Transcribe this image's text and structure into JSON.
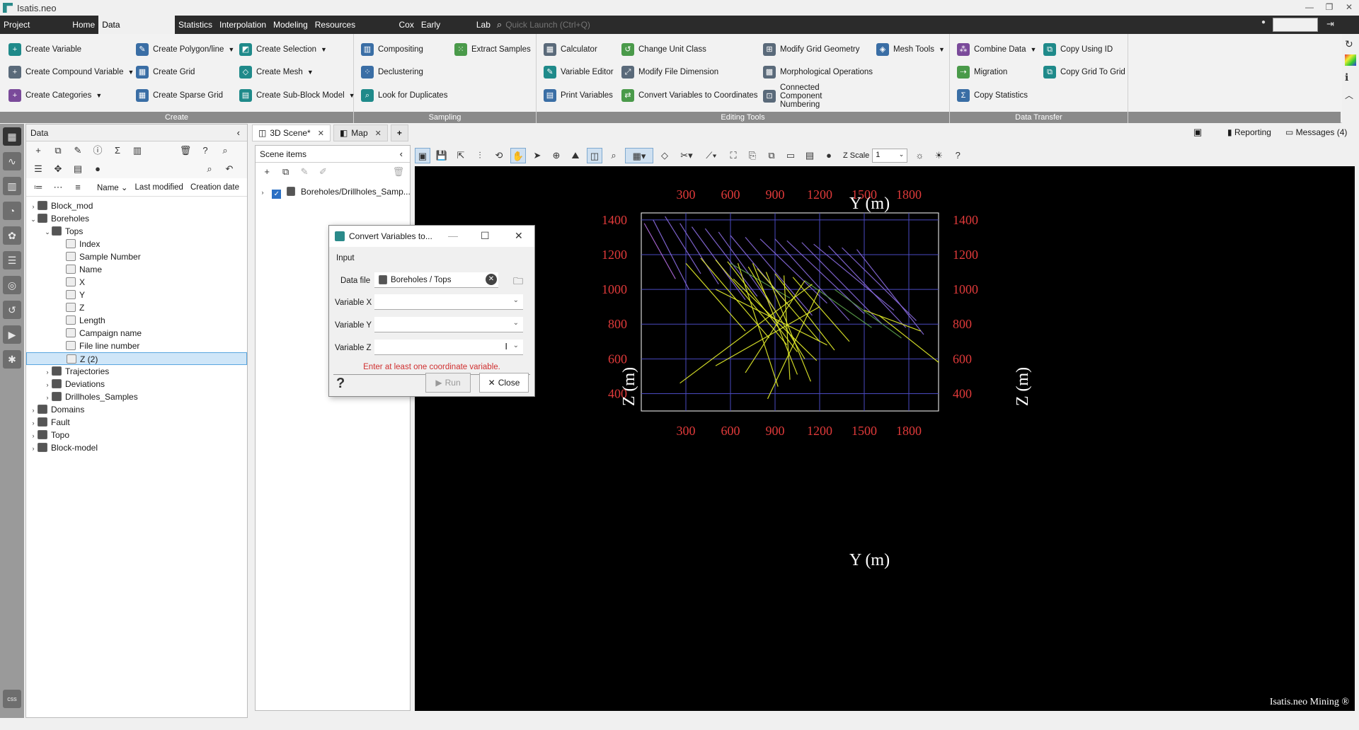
{
  "app": {
    "title": "Isatis.neo"
  },
  "menu": {
    "items": [
      "Project Manager",
      "Home",
      "Data Management",
      "Statistics",
      "Interpolation",
      "Modeling",
      "Resources Workflow",
      "Cox",
      "Early Access",
      "Lab"
    ],
    "active": "Data Management",
    "quick_launch_placeholder": "Quick Launch (Ctrl+Q)"
  },
  "ribbon": {
    "create": {
      "label": "Create",
      "buttons": [
        "Create Variable",
        "Create Compound Variable",
        "Create Categories",
        "Create Polygon/line",
        "Create Grid",
        "Create Sparse Grid",
        "Create Selection",
        "Create Mesh",
        "Create Sub-Block Model"
      ]
    },
    "sampling": {
      "label": "Sampling",
      "buttons": [
        "Compositing",
        "Declustering",
        "Look for Duplicates",
        "Extract Samples"
      ]
    },
    "editing": {
      "label": "Editing Tools",
      "buttons": [
        "Calculator",
        "Variable Editor",
        "Print Variables",
        "Change Unit Class",
        "Modify File Dimension",
        "Convert Variables to Coordinates",
        "Modify Grid Geometry",
        "Morphological Operations",
        "Connected Component Numbering",
        "Mesh Tools"
      ]
    },
    "transfer": {
      "label": "Data Transfer",
      "buttons": [
        "Combine Data",
        "Migration",
        "Copy Statistics",
        "Copy Using ID",
        "Copy Grid To Grid"
      ]
    }
  },
  "tabs": [
    {
      "label": "3D Scene*"
    },
    {
      "label": "Map"
    }
  ],
  "right_toolbar": {
    "reporting": "Reporting",
    "messages": "Messages (4)"
  },
  "data_panel": {
    "title": "Data",
    "columns": [
      "Name",
      "Last modified",
      "Creation date"
    ],
    "tree": [
      {
        "label": "Block_mod",
        "level": 0,
        "expand": "›"
      },
      {
        "label": "Boreholes",
        "level": 0,
        "expand": "⌄"
      },
      {
        "label": "Tops",
        "level": 1,
        "expand": "⌄"
      },
      {
        "label": "Index",
        "level": 2,
        "expand": ""
      },
      {
        "label": "Sample Number",
        "level": 2,
        "expand": ""
      },
      {
        "label": "Name",
        "level": 2,
        "expand": ""
      },
      {
        "label": "X",
        "level": 2,
        "expand": ""
      },
      {
        "label": "Y",
        "level": 2,
        "expand": ""
      },
      {
        "label": "Z",
        "level": 2,
        "expand": ""
      },
      {
        "label": "Length",
        "level": 2,
        "expand": ""
      },
      {
        "label": "Campaign name",
        "level": 2,
        "expand": ""
      },
      {
        "label": "File line number",
        "level": 2,
        "expand": ""
      },
      {
        "label": "Z (2)",
        "level": 2,
        "expand": ""
      },
      {
        "label": "Trajectories",
        "level": 1,
        "expand": "›"
      },
      {
        "label": "Deviations",
        "level": 1,
        "expand": "›"
      },
      {
        "label": "Drillholes_Samples",
        "level": 1,
        "expand": "›"
      },
      {
        "label": "Domains",
        "level": 0,
        "expand": "›"
      },
      {
        "label": "Fault",
        "level": 0,
        "expand": "›"
      },
      {
        "label": "Topo",
        "level": 0,
        "expand": "›"
      },
      {
        "label": "Block-model",
        "level": 0,
        "expand": "›"
      }
    ],
    "selected": "Z (2)"
  },
  "scene_panel": {
    "title": "Scene items",
    "items": [
      "Boreholes/Drillholes_Samp..."
    ]
  },
  "view_toolbar": {
    "zscale_label": "Z Scale",
    "zscale_value": "1"
  },
  "dialog": {
    "title": "Convert Variables to...",
    "section": "Input",
    "data_file_label": "Data file",
    "data_file_value": "Boreholes / Tops",
    "var_x_label": "Variable X",
    "var_y_label": "Variable Y",
    "var_z_label": "Variable Z",
    "error": "Enter at least one coordinate variable.",
    "run": "Run",
    "close": "Close",
    "help": "?"
  },
  "chart_data": {
    "type": "line",
    "xlabel": "Y (m)",
    "ylabel": "Z (m)",
    "xlim": [
      0,
      2000
    ],
    "ylim": [
      300,
      1440
    ],
    "x_ticks": [
      300,
      600,
      900,
      1200,
      1500,
      1800
    ],
    "y_ticks": [
      400,
      600,
      800,
      1000,
      1200,
      1400
    ],
    "grid": true,
    "colors": {
      "upper": "#8a6adf",
      "lower": "#e6f02a",
      "mid": "#5aa04a",
      "ticks": "#e03a3a"
    },
    "series": [
      {
        "color": "#b26adf",
        "x": [
          20,
          230
        ],
        "y": [
          1380,
          1060
        ]
      },
      {
        "color": "#8a6adf",
        "x": [
          80,
          320
        ],
        "y": [
          1400,
          1000
        ]
      },
      {
        "color": "#8a6adf",
        "x": [
          160,
          400
        ],
        "y": [
          1420,
          1090
        ]
      },
      {
        "color": "#8a6adf",
        "x": [
          260,
          520
        ],
        "y": [
          1380,
          1030
        ]
      },
      {
        "color": "#8a6adf",
        "x": [
          340,
          700
        ],
        "y": [
          1360,
          940
        ]
      },
      {
        "color": "#8a6adf",
        "x": [
          430,
          780
        ],
        "y": [
          1350,
          960
        ]
      },
      {
        "color": "#8a6adf",
        "x": [
          520,
          900
        ],
        "y": [
          1330,
          880
        ]
      },
      {
        "color": "#8a6adf",
        "x": [
          600,
          1000
        ],
        "y": [
          1310,
          900
        ]
      },
      {
        "color": "#8a6adf",
        "x": [
          700,
          1150
        ],
        "y": [
          1300,
          850
        ]
      },
      {
        "color": "#8a6adf",
        "x": [
          800,
          1250
        ],
        "y": [
          1290,
          920
        ]
      },
      {
        "color": "#8a6adf",
        "x": [
          900,
          1400
        ],
        "y": [
          1290,
          820
        ]
      },
      {
        "color": "#8a6adf",
        "x": [
          980,
          1500
        ],
        "y": [
          1280,
          860
        ]
      },
      {
        "color": "#8a6adf",
        "x": [
          1080,
          1620
        ],
        "y": [
          1270,
          800
        ]
      },
      {
        "color": "#8a6adf",
        "x": [
          1160,
          1700
        ],
        "y": [
          1260,
          880
        ]
      },
      {
        "color": "#8a6adf",
        "x": [
          1260,
          1780
        ],
        "y": [
          1250,
          780
        ]
      },
      {
        "color": "#8a6adf",
        "x": [
          1350,
          1850
        ],
        "y": [
          1240,
          820
        ]
      },
      {
        "color": "#8a6adf",
        "x": [
          1450,
          1900
        ],
        "y": [
          1230,
          740
        ]
      },
      {
        "color": "#5aa04a",
        "x": [
          1100,
          1550
        ],
        "y": [
          1050,
          780
        ]
      },
      {
        "color": "#5aa04a",
        "x": [
          1300,
          1750
        ],
        "y": [
          1000,
          720
        ]
      },
      {
        "color": "#5aa04a",
        "x": [
          600,
          1000
        ],
        "y": [
          1150,
          950
        ]
      },
      {
        "color": "#e6f02a",
        "x": [
          300,
          700
        ],
        "y": [
          1150,
          760
        ]
      },
      {
        "color": "#e6f02a",
        "x": [
          400,
          860
        ],
        "y": [
          1180,
          720
        ]
      },
      {
        "color": "#e6f02a",
        "x": [
          500,
          980
        ],
        "y": [
          1170,
          680
        ]
      },
      {
        "color": "#e6f02a",
        "x": [
          580,
          1050
        ],
        "y": [
          1160,
          640
        ]
      },
      {
        "color": "#e6f02a",
        "x": [
          650,
          920
        ],
        "y": [
          1150,
          440
        ]
      },
      {
        "color": "#e6f02a",
        "x": [
          720,
          1100
        ],
        "y": [
          1130,
          600
        ]
      },
      {
        "color": "#e6f02a",
        "x": [
          780,
          1200
        ],
        "y": [
          1120,
          700
        ]
      },
      {
        "color": "#e6f02a",
        "x": [
          840,
          1140
        ],
        "y": [
          1100,
          470
        ]
      },
      {
        "color": "#e6f02a",
        "x": [
          900,
          1300
        ],
        "y": [
          1090,
          650
        ]
      },
      {
        "color": "#e6f02a",
        "x": [
          960,
          1000
        ],
        "y": [
          1080,
          480
        ]
      },
      {
        "color": "#e6f02a",
        "x": [
          1020,
          1400
        ],
        "y": [
          1070,
          700
        ]
      },
      {
        "color": "#e6f02a",
        "x": [
          1100,
          700
        ],
        "y": [
          1050,
          520
        ]
      },
      {
        "color": "#e6f02a",
        "x": [
          1150,
          260
        ],
        "y": [
          1030,
          460
        ]
      },
      {
        "color": "#e6f02a",
        "x": [
          1200,
          850
        ],
        "y": [
          1000,
          370
        ]
      },
      {
        "color": "#e6f02a",
        "x": [
          750,
          1050
        ],
        "y": [
          1150,
          510
        ]
      },
      {
        "color": "#e6f02a",
        "x": [
          620,
          1180
        ],
        "y": [
          1060,
          590
        ]
      },
      {
        "color": "#e6f02a",
        "x": [
          500,
          1250
        ],
        "y": [
          1000,
          680
        ]
      },
      {
        "color": "#e6f02a",
        "x": [
          1200,
          500
        ],
        "y": [
          900,
          560
        ]
      },
      {
        "color": "#e6f02a",
        "x": [
          1500,
          1880
        ],
        "y": [
          880,
          760
        ]
      },
      {
        "color": "#e6f02a",
        "x": [
          1600,
          2000
        ],
        "y": [
          850,
          580
        ]
      }
    ]
  }
}
